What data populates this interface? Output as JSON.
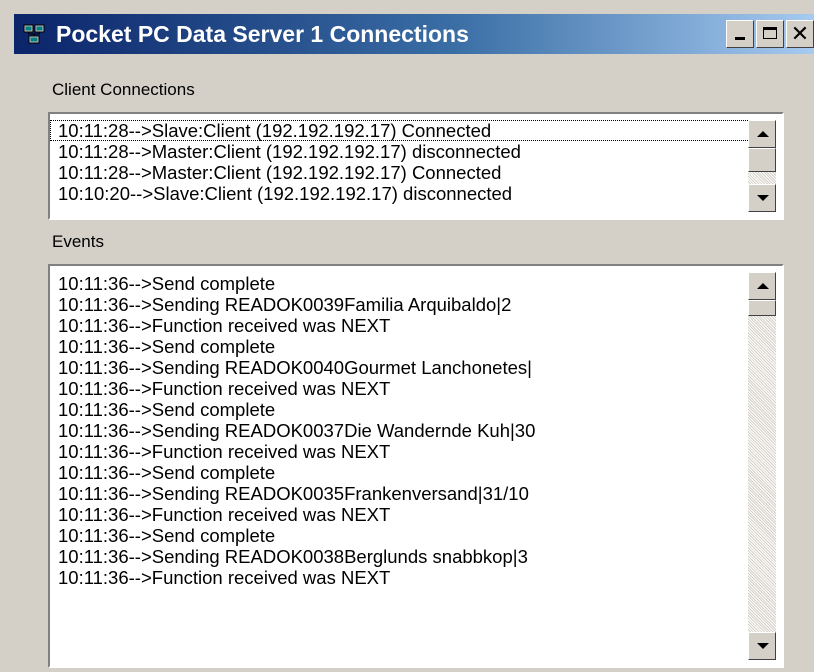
{
  "window": {
    "title": "Pocket PC Data Server 1 Connections",
    "icon": "network-computers-icon",
    "controls": {
      "minimize": "minimize-icon",
      "maximize": "maximize-icon",
      "close_glyph": "✕"
    }
  },
  "client_connections": {
    "label": "Client Connections",
    "items": [
      "10:11:28-->Slave:Client (192.192.192.17) Connected",
      "10:11:28-->Master:Client (192.192.192.17) disconnected",
      "10:11:28-->Master:Client (192.192.192.17) Connected",
      "10:10:20-->Slave:Client (192.192.192.17) disconnected"
    ],
    "focused_index": 0
  },
  "events": {
    "label": "Events",
    "items": [
      "10:11:36-->Send complete",
      "10:11:36-->Sending READOK0039Familia Arquibaldo|2",
      "10:11:36-->Function received was NEXT",
      "10:11:36-->Send complete",
      "10:11:36-->Sending READOK0040Gourmet Lanchonetes|",
      "10:11:36-->Function received was NEXT",
      "10:11:36-->Send complete",
      "10:11:36-->Sending READOK0037Die Wandernde Kuh|30",
      "10:11:36-->Function received was NEXT",
      "10:11:36-->Send complete",
      "10:11:36-->Sending READOK0035Frankenversand|31/10",
      "10:11:36-->Function received was NEXT",
      "10:11:36-->Send complete",
      "10:11:36-->Sending READOK0038Berglunds snabbkop|3",
      "10:11:36-->Function received was NEXT"
    ]
  },
  "colors": {
    "titlebar_start": "#0b246a",
    "titlebar_end": "#a6caf0",
    "face": "#d4d0c8"
  }
}
